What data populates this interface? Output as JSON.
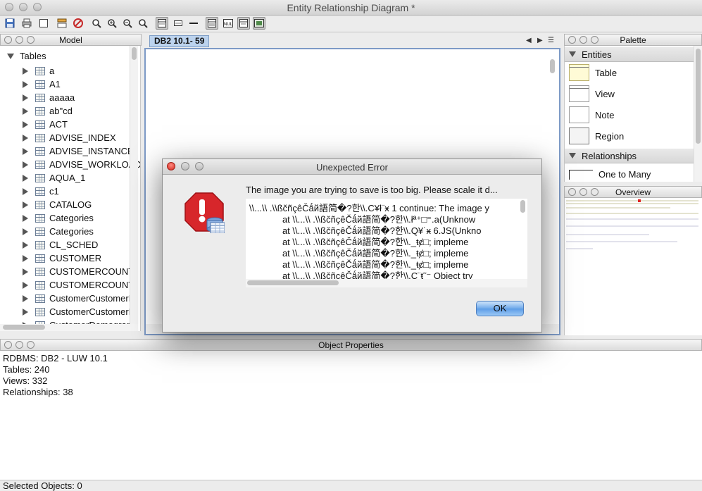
{
  "window": {
    "title": "Entity Relationship Diagram *"
  },
  "model": {
    "title": "Model",
    "root_label": "Tables",
    "tables": [
      "a",
      "A1",
      "aaaaa",
      "ab\"cd",
      "ACT",
      "ADVISE_INDEX",
      "ADVISE_INSTANCE",
      "ADVISE_WORKLOAD",
      "AQUA_1",
      "c1",
      "CATALOG",
      "Categories",
      "Categories",
      "CL_SCHED",
      "CUSTOMER",
      "CUSTOMERCOUNT",
      "CUSTOMERCOUNT",
      "CustomerCustomerD",
      "CustomerCustomerD",
      "CustomerDemograp"
    ]
  },
  "diagram": {
    "tab_label": "DB2 10.1- 59"
  },
  "palette": {
    "title": "Palette",
    "entities_header": "Entities",
    "entities": [
      "Table",
      "View",
      "Note",
      "Region"
    ],
    "relationships_header": "Relationships",
    "relationships": [
      "One to Many"
    ]
  },
  "overview": {
    "title": "Overview"
  },
  "properties": {
    "title": "Object Properties",
    "lines": [
      "RDBMS: DB2 - LUW 10.1",
      "Tables: 240",
      "Views: 332",
      "Relationships: 38"
    ]
  },
  "status": {
    "text": "Selected Objects: 0"
  },
  "dialog": {
    "title": "Unexpected Error",
    "message": "The image you are trying to save is too big.  Please scale it d...",
    "stack_lines": [
      "\\\\...\\\\ .\\\\ßčñçêČǻй語简�?한\\\\.C¥ł¨ӿ 1 continue: The image y",
      "             at \\\\...\\\\ .\\\\ßčñçêČǻй語简�?한\\\\.łª⁺□⁼.a(Unknow",
      "             at \\\\...\\\\ .\\\\ßčñçêČǻй語简�?한\\\\.Q¥˙ӿ 6.JS(Unkno",
      "             at \\\\...\\\\ .\\\\ßčñçêČǻй語简�?한\\\\._ŧȼ□; impleme",
      "             at \\\\...\\\\ .\\\\ßčñçêČǻй語简�?한\\\\._ŧȼ□; impleme",
      "             at \\\\...\\\\ .\\\\ßčñçêČǻй語简�?한\\\\._ŧȼ□; impleme",
      "             at \\\\...\\\\ .\\\\ßčñçêČǻй語简�?한\\\\.C¨ŧ˜⁻ Object try"
    ],
    "ok_label": "OK"
  },
  "icons": {
    "toolbar": [
      "save-icon",
      "print-icon",
      "page-setup-icon",
      "layout-icon",
      "delete-icon",
      "zoom-icon",
      "zoom-in-icon",
      "zoom-out-icon",
      "zoom-fit-icon",
      "table-display-icon",
      "columns-icon",
      "line-icon",
      "grid-icon",
      "null-icon",
      "note-icon",
      "export-image-icon"
    ],
    "dialog": "error-stop-icon"
  },
  "colors": {
    "tab_bg": "#bcd3ee",
    "canvas_border": "#7d9ac6",
    "ok_button": "#5c9ce6",
    "error_red": "#d7262b"
  }
}
